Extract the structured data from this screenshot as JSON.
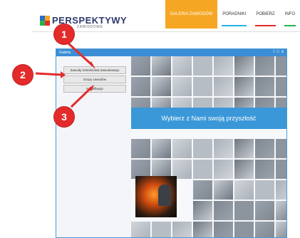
{
  "header": {
    "logo_text": "PERSPEKTYWY",
    "logo_sub": "ZAWODOWE",
    "logo_colors": [
      "#2a6cc9",
      "#f5a623",
      "#2bb14a",
      "#e32b2b"
    ]
  },
  "nav": [
    {
      "label": "GALERIA ZAWODÓW",
      "active": true,
      "underline": "#f5a623"
    },
    {
      "label": "PORADNIKI",
      "active": false,
      "underline": "#2bb1e6"
    },
    {
      "label": "POBIERZ",
      "active": false,
      "underline": "#e32b2b"
    },
    {
      "label": "INFO",
      "active": false,
      "underline": "#2bb14a"
    }
  ],
  "window": {
    "title": "Galeria",
    "controls": [
      "i",
      "□",
      "x"
    ]
  },
  "menu": [
    {
      "label": "Zawody Szkolnictwa Zawodowego"
    },
    {
      "label": "Grupy zawodów"
    },
    {
      "label": "Kwalifikacje"
    }
  ],
  "banner": "Wybierz z Nami swoją przyszłość",
  "callouts": [
    "1",
    "2",
    "3"
  ],
  "colors": {
    "accent": "#3a98d9",
    "callout": "#e32b2b",
    "orange": "#f5a623"
  }
}
